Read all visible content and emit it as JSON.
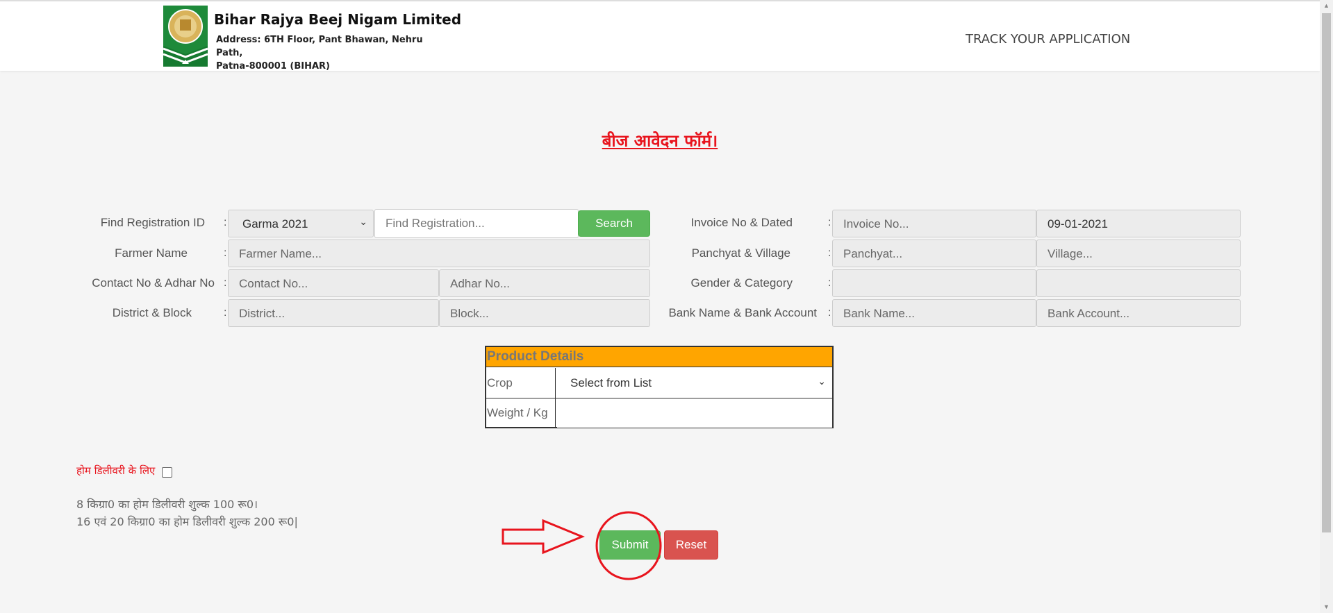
{
  "header": {
    "org_name": "Bihar Rajya Beej Nigam Limited",
    "address_line1": "Address: 6TH Floor, Pant Bhawan,  Nehru Path,",
    "address_line2": "Patna-800001 (BIHAR)",
    "track_link": "TRACK YOUR APPLICATION"
  },
  "form": {
    "title": "बीज आवेदन फॉर्म।",
    "find_registration": {
      "label": "Find Registration ID",
      "season_value": "Garma 2021",
      "input_placeholder": "Find Registration...",
      "search_button": "Search"
    },
    "farmer_name": {
      "label": "Farmer Name",
      "placeholder": "Farmer Name..."
    },
    "contact": {
      "label": "Contact No & Adhar No",
      "contact_placeholder": "Contact No...",
      "adhar_placeholder": "Adhar No..."
    },
    "district": {
      "label": "District & Block",
      "district_placeholder": "District...",
      "block_placeholder": "Block..."
    },
    "invoice": {
      "label": "Invoice No & Dated",
      "invoice_placeholder": "Invoice No...",
      "date_value": "09-01-2021"
    },
    "panchyat": {
      "label": "Panchyat & Village",
      "panchyat_placeholder": "Panchyat...",
      "village_placeholder": "Village..."
    },
    "gender": {
      "label": "Gender & Category",
      "gender_value": "",
      "category_value": ""
    },
    "bank": {
      "label": "Bank Name & Bank Account",
      "bank_placeholder": "Bank Name...",
      "account_placeholder": "Bank Account..."
    },
    "colon": ":"
  },
  "product": {
    "header": "Product Details",
    "crop_label": "Crop",
    "crop_value": "Select from List",
    "weight_label": "Weight / Kg",
    "weight_value": ""
  },
  "delivery": {
    "home_label": "होम डिलीवरी के लिए",
    "home_checked": false,
    "note_line1": "8 किग्रा0 का होम डिलीवरी शुल्क 100 रू0।",
    "note_line2": "16 एवं 20 किग्रा0 का होम डिलीवरी शुल्क 200 रू0|"
  },
  "actions": {
    "submit": "Submit",
    "reset": "Reset"
  },
  "colors": {
    "accent_red": "#e8141d",
    "success_green": "#5cb85c",
    "danger_red": "#d9534f",
    "product_header": "#ffa500"
  }
}
